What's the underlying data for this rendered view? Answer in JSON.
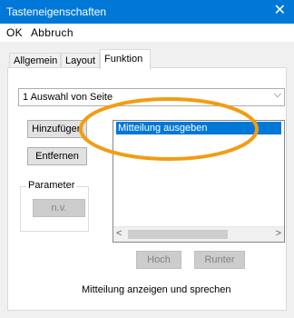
{
  "window": {
    "title": "Tasteneigenschaften",
    "close_glyph": "✕"
  },
  "menu": {
    "ok": "OK",
    "cancel": "Abbruch"
  },
  "tabs": [
    {
      "label": "Allgemein",
      "active": false
    },
    {
      "label": "Layout",
      "active": false
    },
    {
      "label": "Funktion",
      "active": true
    }
  ],
  "page_select": {
    "value": "1 Auswahl von Seite",
    "arrow": "⌵"
  },
  "buttons": {
    "add": "Hinzufügen",
    "remove": "Entfernen",
    "param_value": "n.v.",
    "up": "Hoch",
    "down": "Runter"
  },
  "param_group": {
    "legend": "Parameter"
  },
  "actions_list": {
    "items": [
      "Mitteilung ausgeben"
    ],
    "scroll_left": "<",
    "scroll_right": ">"
  },
  "description": "Mitteilung anzeigen und sprechen",
  "colors": {
    "selection": "#0078d7",
    "annotation": "#f39c12"
  }
}
